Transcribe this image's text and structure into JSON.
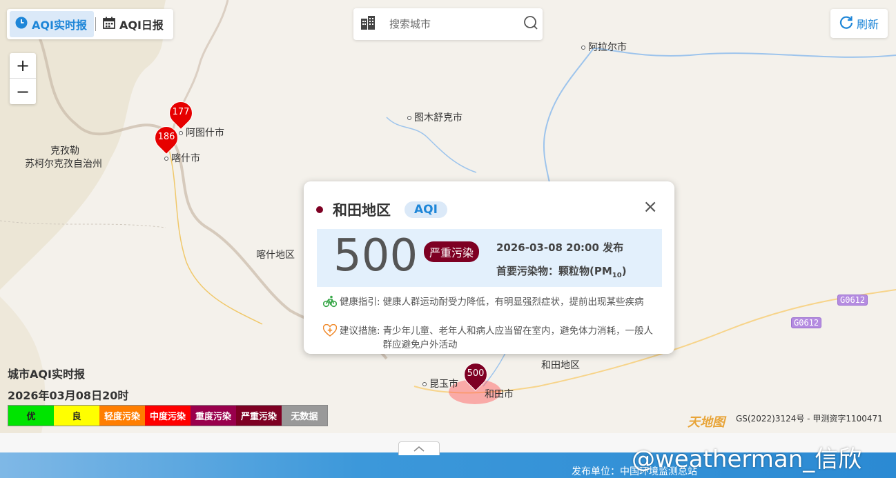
{
  "tabs": [
    {
      "label": "AQI实时报",
      "active": true
    },
    {
      "label": "AQI日报",
      "active": false
    }
  ],
  "search": {
    "placeholder": "搜索城市"
  },
  "refresh_label": "刷新",
  "zoom": {
    "in": "+",
    "out": "−"
  },
  "places": {
    "alaer": "阿拉尔市",
    "tumushuke": "图木舒克市",
    "atushi": "阿图什市",
    "kashi_city": "喀什市",
    "kezile_1": "克孜勒",
    "kezile_2": "苏柯尔克孜自治州",
    "kashi_region": "喀什地区",
    "hetian_region": "和田地区",
    "kunyu": "昆玉市",
    "hetian_city": "和田市"
  },
  "highways": [
    "G0612",
    "G0612"
  ],
  "markers": [
    {
      "value": "177",
      "color": "#e60000"
    },
    {
      "value": "186",
      "color": "#e60000"
    },
    {
      "value": "500",
      "color": "#7e0023"
    }
  ],
  "popup": {
    "region": "和田地区",
    "tag": "AQI",
    "close": "×",
    "aqi": "500",
    "level": "严重污染",
    "published": "2026-03-08 20:00 发布",
    "pollutant_label": "首要污染物：颗粒物(PM",
    "pollutant_sub": "10",
    "pollutant_end": ")",
    "health_label": "健康指引:",
    "health_text": "健康人群运动耐受力降低，有明显强烈症状，提前出现某些疾病",
    "advice_label": "建议措施:",
    "advice_text": "青少年儿童、老年人和病人应当留在室内，避免体力消耗，一般人群应避免户外活动"
  },
  "legend": {
    "title": "城市AQI实时报",
    "date": "2026年03月08日20时",
    "levels": [
      {
        "label": "优",
        "color": "#00e400",
        "text": "#222"
      },
      {
        "label": "良",
        "color": "#ffff00",
        "text": "#222"
      },
      {
        "label": "轻度污染",
        "color": "#ff7e00",
        "text": "#fff"
      },
      {
        "label": "中度污染",
        "color": "#ff0000",
        "text": "#fff"
      },
      {
        "label": "重度污染",
        "color": "#99004c",
        "text": "#fff"
      },
      {
        "label": "严重污染",
        "color": "#7e0023",
        "text": "#fff"
      },
      {
        "label": "无数据",
        "color": "#999999",
        "text": "#fff"
      }
    ]
  },
  "map_logo": "天地图",
  "license": "GS(2022)3124号 - 甲测资字1100471",
  "footer": {
    "publisher": "发布单位：中国环境监测总站",
    "watermark": "@weatherman_信欣"
  }
}
